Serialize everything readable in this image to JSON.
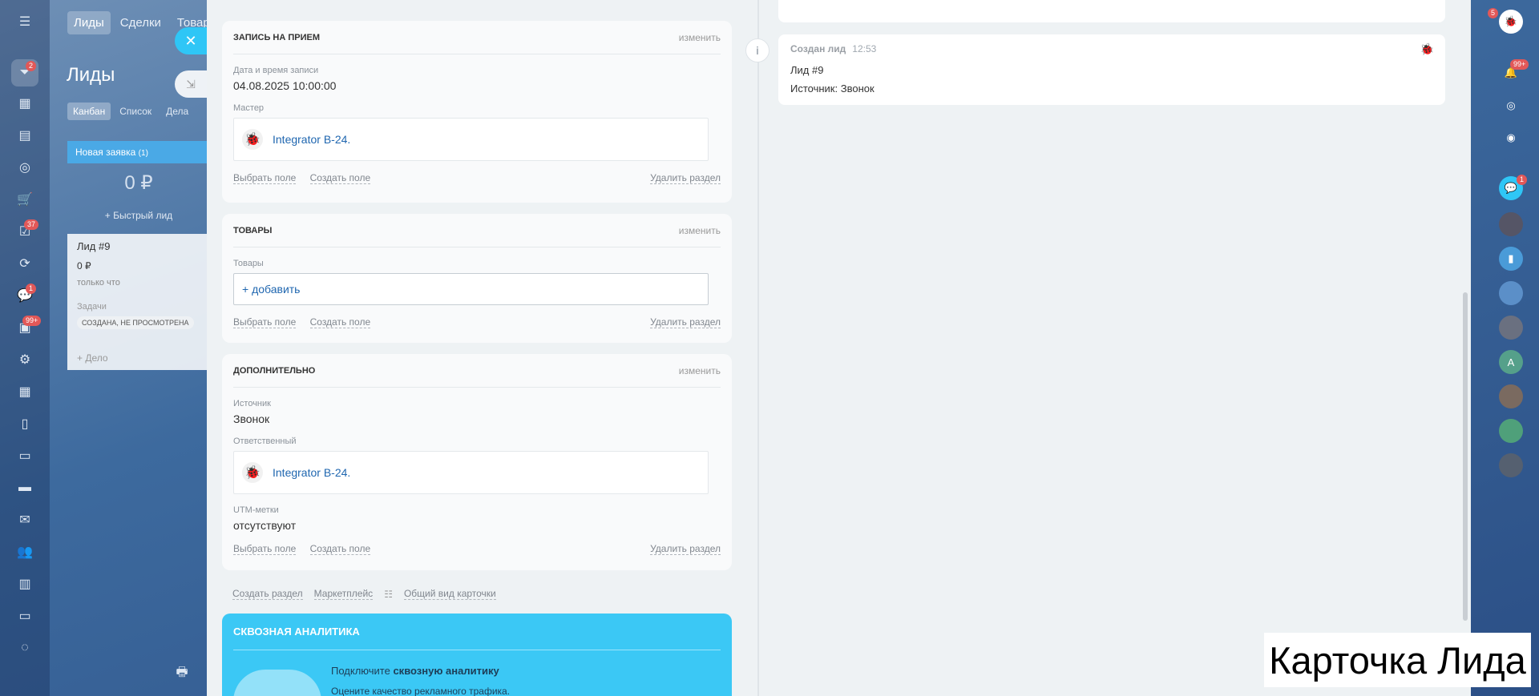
{
  "crm": {
    "nav": [
      "Лиды",
      "Сделки",
      "Товар"
    ],
    "title": "Лиды",
    "view_tabs": [
      "Канбан",
      "Список",
      "Дела"
    ],
    "column_title": "Новая заявка",
    "column_count": "(1)",
    "column_sum": "0 ₽",
    "quick_lead": "+ Быстрый лид",
    "lead": {
      "title": "Лид #9",
      "amount": "0 ₽",
      "time": "только что",
      "task_label": "Задачи",
      "task_badge": "СОЗДАНА, НЕ ПРОСМОТРЕНА",
      "add_deal": "+ Дело",
      "only": "только ч"
    }
  },
  "left_rail_badges": {
    "funnel": "2",
    "tasks": "37",
    "chat": "1",
    "feed": "99+"
  },
  "right_rail_badges": {
    "notifications": "99+",
    "chat": "1",
    "top": "5"
  },
  "sections": {
    "appointment": {
      "title": "ЗАПИСЬ НА ПРИЕМ",
      "edit": "изменить",
      "date_label": "Дата и время записи",
      "date_value": "04.08.2025 10:00:00",
      "master_label": "Мастер",
      "master_name": "Integrator B-24.",
      "select_field": "Выбрать поле",
      "create_field": "Создать поле",
      "delete_section": "Удалить раздел"
    },
    "products": {
      "title": "ТОВАРЫ",
      "edit": "изменить",
      "label": "Товары",
      "add": "+ добавить",
      "select_field": "Выбрать поле",
      "create_field": "Создать поле",
      "delete_section": "Удалить раздел"
    },
    "additional": {
      "title": "ДОПОЛНИТЕЛЬНО",
      "edit": "изменить",
      "source_label": "Источник",
      "source_value": "Звонок",
      "responsible_label": "Ответственный",
      "responsible_name": "Integrator B-24.",
      "utm_label": "UTM-метки",
      "utm_value": "отсутствуют",
      "select_field": "Выбрать поле",
      "create_field": "Создать поле",
      "delete_section": "Удалить раздел"
    }
  },
  "bottom_links": {
    "create_section": "Создать раздел",
    "marketplace": "Маркетплейс",
    "card_view": "Общий вид карточки"
  },
  "promo": {
    "title": "СКВОЗНАЯ АНАЛИТИКА",
    "text_prefix": "Подключите ",
    "text_bold": "сквозную аналитику",
    "text2": "Оцените качество рекламного трафика."
  },
  "timeline": {
    "event_title": "Создан лид",
    "event_time": "12:53",
    "line1": "Лид #9",
    "line2": "Источник: Звонок"
  },
  "caption": "Карточка Лида"
}
